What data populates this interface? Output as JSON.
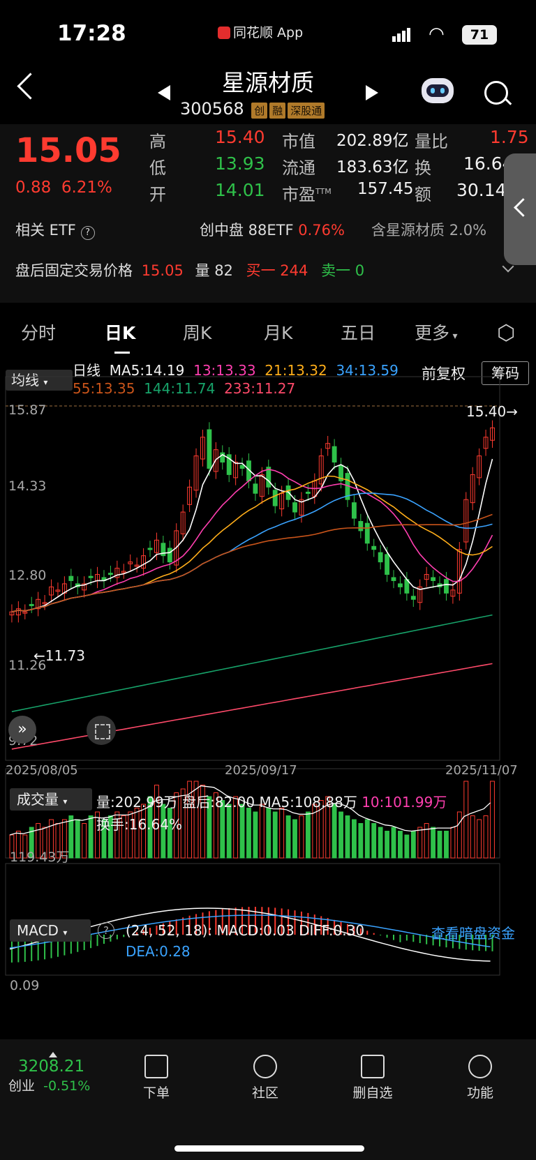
{
  "status_bar": {
    "time": "17:28",
    "app": "同花顺 App",
    "battery": "71"
  },
  "header": {
    "title": "星源材质",
    "code": "300568",
    "badges": [
      "创",
      "融",
      "深股通"
    ]
  },
  "quote": {
    "price": "15.05",
    "change": "0.88",
    "change_pct": "6.21%",
    "high_label": "高",
    "high": "15.40",
    "low_label": "低",
    "low": "13.93",
    "open_label": "开",
    "open": "14.01",
    "mcap_label": "市值",
    "mcap": "202.89亿",
    "float_label": "流通",
    "float": "183.63亿",
    "pe_label": "市盈",
    "pe_sup": "TTM",
    "pe": "157.45",
    "vr_label": "量比",
    "vr": "1.75",
    "turn_label": "换",
    "turn": "16.64",
    "amt_label": "额",
    "amt": "30.14",
    "etf_label": "相关 ETF",
    "etf_name": "创中盘 88ETF",
    "etf_pct": "0.76%",
    "etf_hold": "含星源材质",
    "etf_hold_pct": "2.0%",
    "after_label": "盘后固定交易价格",
    "after_price": "15.05",
    "after_vol_label": "量",
    "after_vol": "82",
    "buy1": "买一 244",
    "sell1": "卖一 0"
  },
  "tabs": [
    "分时",
    "日K",
    "周K",
    "月K",
    "五日",
    "更多"
  ],
  "ma": {
    "selector": "均线",
    "line": "日线",
    "ma5": "MA5:14.19",
    "ma13": "13:13.33",
    "ma21": "21:13.32",
    "ma34": "34:13.59",
    "ma55": "55:13.35",
    "ma144": "144:11.74",
    "ma233": "233:11.27",
    "adj": "前复权",
    "chip": "筹码"
  },
  "axis": {
    "y_labels": [
      "15.87",
      "14.33",
      "12.80",
      "11.26",
      "9.72"
    ],
    "x_labels": [
      "2025/08/05",
      "2025/09/17",
      "2025/11/07"
    ],
    "high_mark": "15.40→",
    "low_mark": "←11.73"
  },
  "volume": {
    "selector": "成交量",
    "vol": "量:202.99万",
    "after": "盘后:82.00",
    "ma5": "MA5:108.88万",
    "ma10": "10:101.99万",
    "turn": "换手:16.64%",
    "y_label": "119.43万"
  },
  "macd": {
    "selector": "MACD",
    "params": "(24, 52, 18): MACD:0.03",
    "diff": "DIFF:0.30",
    "dea": "DEA:0.28",
    "y_label": "0.09",
    "link": "查看暗盘资金"
  },
  "bottom": {
    "index_value": "3208.21",
    "index_name": "创业",
    "index_pct": "-0.51%",
    "items": [
      "下单",
      "社区",
      "删自选",
      "功能"
    ]
  },
  "colors": {
    "up": "#ff3b30",
    "down": "#2fc14a",
    "ma5": "#ffffff",
    "ma13": "#ff3fb0",
    "ma21": "#ffae1a",
    "ma34": "#3aa3ff",
    "ma55": "#c9541a",
    "ma144": "#17a36a",
    "ma233": "#ff4a6a"
  },
  "chart_data": {
    "type": "candlestick",
    "ylim": [
      9.72,
      15.87
    ],
    "x_labels": [
      "2025/08/05",
      "2025/09/17",
      "2025/11/07"
    ],
    "ma_values": {
      "MA5": 14.19,
      "MA13": 13.33,
      "MA21": 13.32,
      "MA34": 13.59,
      "MA55": 13.35,
      "MA144": 11.74,
      "MA233": 11.27
    },
    "closes": [
      12.1,
      12.15,
      12.1,
      12.2,
      12.3,
      12.25,
      12.5,
      12.45,
      12.55,
      12.6,
      12.5,
      12.55,
      12.65,
      12.7,
      12.6,
      12.7,
      12.8,
      12.75,
      12.9,
      12.85,
      13.0,
      13.1,
      13.25,
      13.0,
      12.9,
      13.4,
      13.7,
      14.1,
      14.6,
      14.9,
      14.4,
      14.7,
      14.5,
      14.3,
      14.5,
      14.4,
      14.2,
      14.0,
      14.3,
      14.1,
      13.8,
      14.0,
      13.9,
      13.7,
      13.9,
      14.0,
      14.2,
      14.6,
      14.8,
      14.5,
      14.2,
      13.9,
      13.6,
      13.4,
      13.2,
      13.1,
      12.9,
      12.7,
      12.6,
      12.5,
      12.4,
      12.3,
      12.5,
      12.7,
      12.6,
      12.5,
      12.4,
      12.45,
      13.1,
      13.9,
      14.3,
      14.6,
      14.9,
      15.05
    ],
    "volume_rel": [
      0.3,
      0.35,
      0.3,
      0.4,
      0.45,
      0.4,
      0.5,
      0.45,
      0.5,
      0.55,
      0.5,
      0.45,
      0.55,
      0.6,
      0.5,
      0.55,
      0.6,
      0.55,
      0.6,
      0.65,
      0.7,
      0.8,
      0.95,
      0.7,
      0.65,
      0.85,
      0.9,
      1.0,
      1.0,
      0.95,
      0.8,
      0.85,
      0.75,
      0.7,
      0.8,
      0.7,
      0.65,
      0.6,
      0.7,
      0.65,
      0.6,
      0.65,
      0.55,
      0.5,
      0.55,
      0.6,
      0.7,
      0.75,
      0.8,
      0.7,
      0.6,
      0.55,
      0.5,
      0.45,
      0.5,
      0.45,
      0.4,
      0.35,
      0.4,
      0.35,
      0.3,
      0.35,
      0.4,
      0.45,
      0.4,
      0.35,
      0.35,
      0.4,
      0.6,
      1.0,
      0.55,
      0.5,
      0.55,
      1.0
    ]
  }
}
